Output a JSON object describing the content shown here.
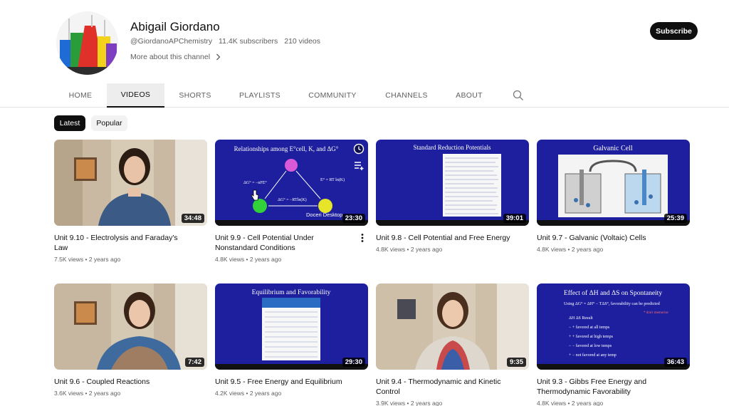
{
  "channel": {
    "name": "Abigail Giordano",
    "handle": "@GiordanoAPChemistry",
    "subscribers": "11.4K subscribers",
    "videos_count": "210 videos",
    "more_about": "More about this channel",
    "subscribe_label": "Subscribe"
  },
  "tabs": [
    {
      "label": "HOME"
    },
    {
      "label": "VIDEOS"
    },
    {
      "label": "SHORTS"
    },
    {
      "label": "PLAYLISTS"
    },
    {
      "label": "COMMUNITY"
    },
    {
      "label": "CHANNELS"
    },
    {
      "label": "ABOUT"
    }
  ],
  "active_tab": "VIDEOS",
  "chips": [
    {
      "label": "Latest"
    },
    {
      "label": "Popular"
    }
  ],
  "thumb_text": {
    "v1": "Relationships among E°cell, K, and ΔG°",
    "v1_docs": "Doceri Desktop",
    "v2": "Standard Reduction Potentials",
    "v3": "Galvanic Cell",
    "v5": "Equilibrium and Favorability",
    "v7": "Effect of ΔH and ΔS on Spontaneity"
  },
  "videos": [
    {
      "title": "Unit 9.10 - Electrolysis and Faraday's Law",
      "views": "7.5K views",
      "age": "2 years ago",
      "duration": "34:48"
    },
    {
      "title": "Unit 9.9 - Cell Potential Under Nonstandard Conditions",
      "views": "4.8K views",
      "age": "2 years ago",
      "duration": "23:30"
    },
    {
      "title": "Unit 9.8 - Cell Potential and Free Energy",
      "views": "4.8K views",
      "age": "2 years ago",
      "duration": "39:01"
    },
    {
      "title": "Unit 9.7 - Galvanic (Voltaic) Cells",
      "views": "4.8K views",
      "age": "2 years ago",
      "duration": "25:39"
    },
    {
      "title": "Unit 9.6 - Coupled Reactions",
      "views": "3.6K views",
      "age": "2 years ago",
      "duration": "7:42"
    },
    {
      "title": "Unit 9.5 - Free Energy and Equilibrium",
      "views": "4.2K views",
      "age": "2 years ago",
      "duration": "29:30"
    },
    {
      "title": "Unit 9.4 - Thermodynamic and Kinetic Control",
      "views": "3.9K views",
      "age": "2 years ago",
      "duration": "9:35"
    },
    {
      "title": "Unit 9.3 - Gibbs Free Energy and Thermodynamic Favorability",
      "views": "4.8K views",
      "age": "2 years ago",
      "duration": "36:43"
    }
  ],
  "colors": {
    "accent": "#0f0f0f",
    "slide_blue": "#1d1f9e",
    "meta_gray": "#606060"
  }
}
